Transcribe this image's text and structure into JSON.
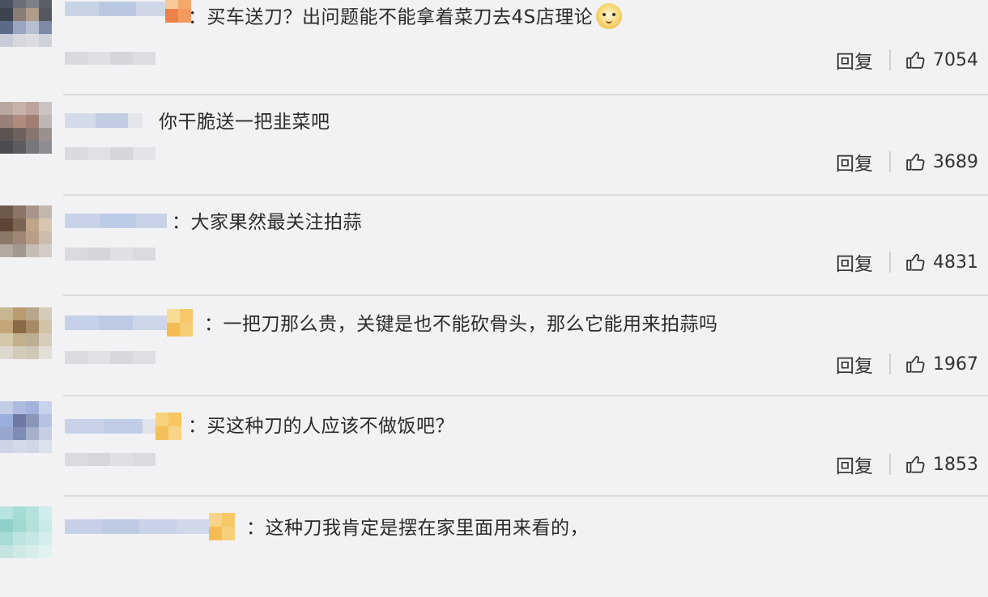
{
  "reply_label": "回复",
  "comments": [
    {
      "text": "：买车送刀？出问题能不能拿着菜刀去4S店理论",
      "has_emoji": true,
      "emoji_icon": "doge-emoji-icon",
      "likes": "7054"
    },
    {
      "text": "你干脆送一把韭菜吧",
      "has_emoji": false,
      "likes": "3689"
    },
    {
      "text": "：大家果然最关注拍蒜",
      "has_emoji": false,
      "likes": "4831"
    },
    {
      "text": "：一把刀那么贵，关键是也不能砍骨头，那么它能用来拍蒜吗",
      "has_emoji": false,
      "likes": "1967"
    },
    {
      "text": "：买这种刀的人应该不做饭吧？",
      "has_emoji": false,
      "likes": "1853"
    },
    {
      "text": "：这种刀我肯定是摆在家里面用来看的，",
      "has_emoji": false,
      "likes": ""
    }
  ],
  "colors": {
    "background": "#f2f2f4",
    "divider": "#dcdcdf",
    "text": "#2b2b2b"
  }
}
